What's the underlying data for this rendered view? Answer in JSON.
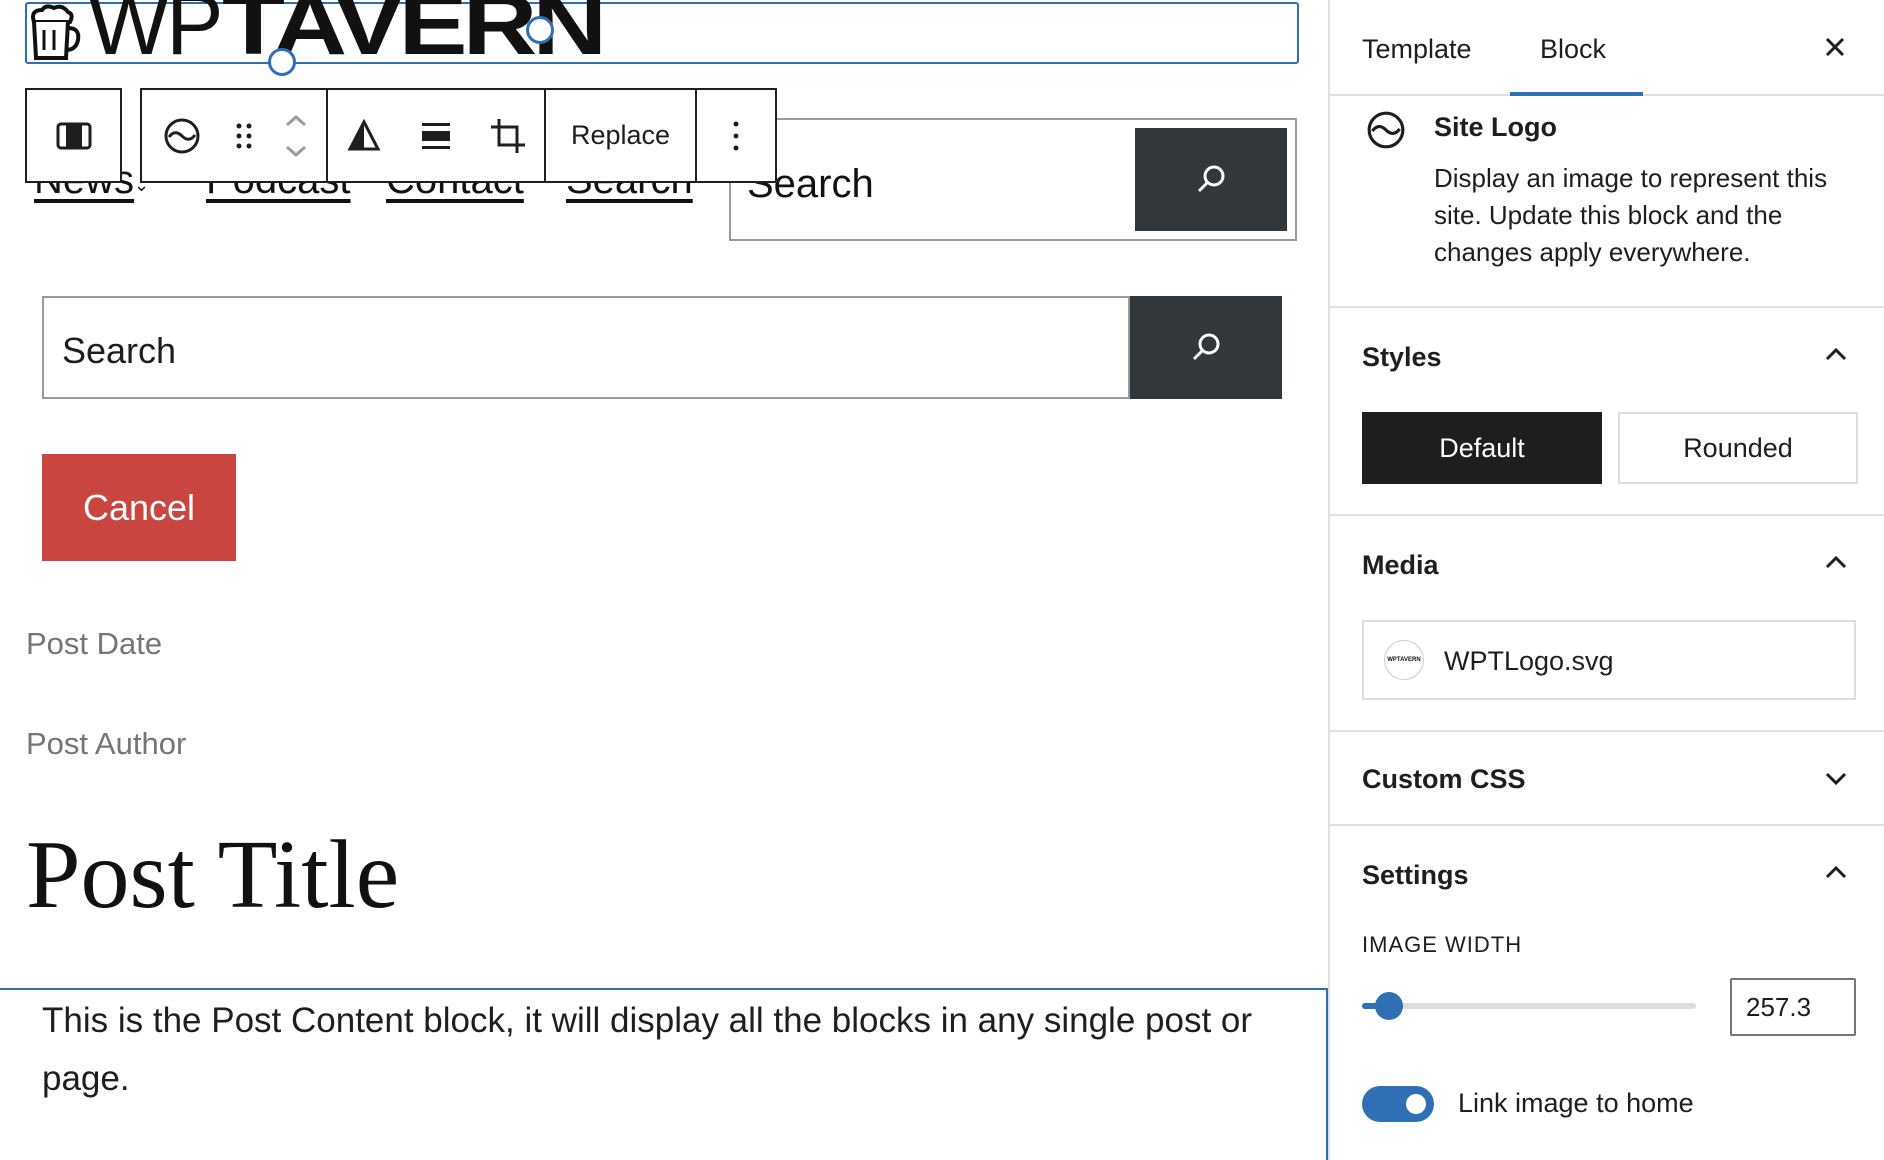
{
  "canvas": {
    "logo": {
      "wp": "WP",
      "tavern": "TAVERN"
    },
    "nav": {
      "items": [
        "News",
        "Podcast",
        "Contact",
        "Search"
      ]
    },
    "top_search": {
      "text": "Search"
    },
    "toolbar": {
      "replace_label": "Replace"
    },
    "search": {
      "placeholder": "Search"
    },
    "cancel_label": "Cancel",
    "post_date": "Post Date",
    "post_author": "Post Author",
    "post_title": "Post Title",
    "post_content": "This is the Post Content block, it will display all the blocks in any single post or page."
  },
  "sidebar": {
    "tabs": [
      {
        "label": "Template"
      },
      {
        "label": "Block"
      }
    ],
    "active_tab": "Block",
    "block_card": {
      "title": "Site Logo",
      "description": "Display an image to represent this site. Update this block and the changes apply everywhere."
    },
    "styles": {
      "title": "Styles",
      "options": [
        {
          "label": "Default"
        },
        {
          "label": "Rounded"
        }
      ],
      "selected": "Default"
    },
    "media": {
      "title": "Media",
      "file_name": "WPTLogo.svg",
      "thumb_text": "WPTAVERN"
    },
    "custom_css": {
      "title": "Custom CSS"
    },
    "settings": {
      "title": "Settings",
      "image_width_label": "IMAGE WIDTH",
      "image_width_value": "257.3",
      "slider_fraction": 0.08,
      "link_label": "Link image to home",
      "link_enabled": true
    }
  },
  "colors": {
    "accent": "#2f6fb3",
    "cancel": "#c9453f",
    "search_button": "#32373c",
    "dark": "#1e1e1e"
  }
}
